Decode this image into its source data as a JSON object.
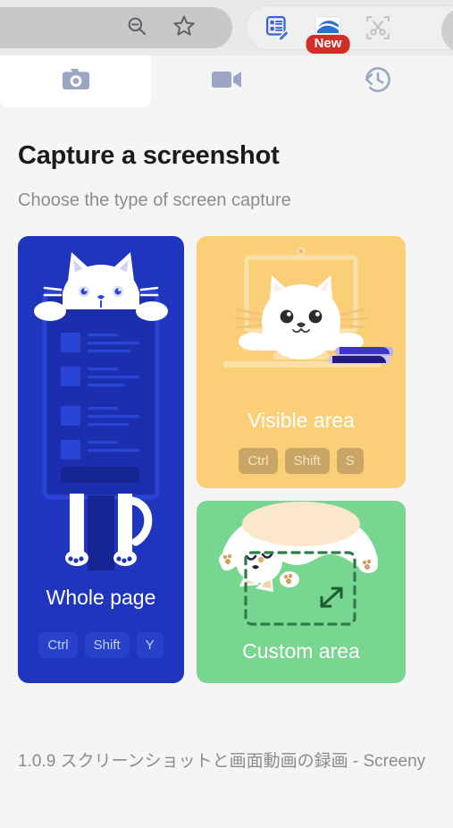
{
  "browser": {
    "omnibox_icons": [
      "zoom-out-icon",
      "bookmark-star-icon"
    ],
    "extension_icons": [
      {
        "name": "reading-list-icon",
        "badge": null
      },
      {
        "name": "screenshot-extension-icon",
        "badge": "New"
      },
      {
        "name": "scissors-capture-icon",
        "badge": null
      },
      {
        "name": "screeny-video-icon",
        "badge": null
      }
    ]
  },
  "tabs": [
    {
      "id": "screenshot",
      "icon": "camera-icon",
      "active": true
    },
    {
      "id": "recording",
      "icon": "video-camera-icon",
      "active": false
    },
    {
      "id": "history",
      "icon": "history-clock-icon",
      "active": false
    }
  ],
  "header": {
    "title": "Capture a screenshot",
    "subtitle": "Choose the type of screen capture"
  },
  "capture_options": [
    {
      "id": "whole-page",
      "label": "Whole page",
      "shortcut": [
        "Ctrl",
        "Shift",
        "Y"
      ],
      "color": "#1f35bd",
      "art": "cat-over-document"
    },
    {
      "id": "visible-area",
      "label": "Visible area",
      "shortcut": [
        "Ctrl",
        "Shift",
        "S"
      ],
      "color": "#facf78",
      "art": "cat-in-monitor"
    },
    {
      "id": "custom-area",
      "label": "Custom area",
      "shortcut": [],
      "color": "#77d68f",
      "art": "cat-upside-down-selection"
    }
  ],
  "footer": {
    "text": "1.0.9 スクリーンショットと画面動画の録画 - Screeny"
  }
}
